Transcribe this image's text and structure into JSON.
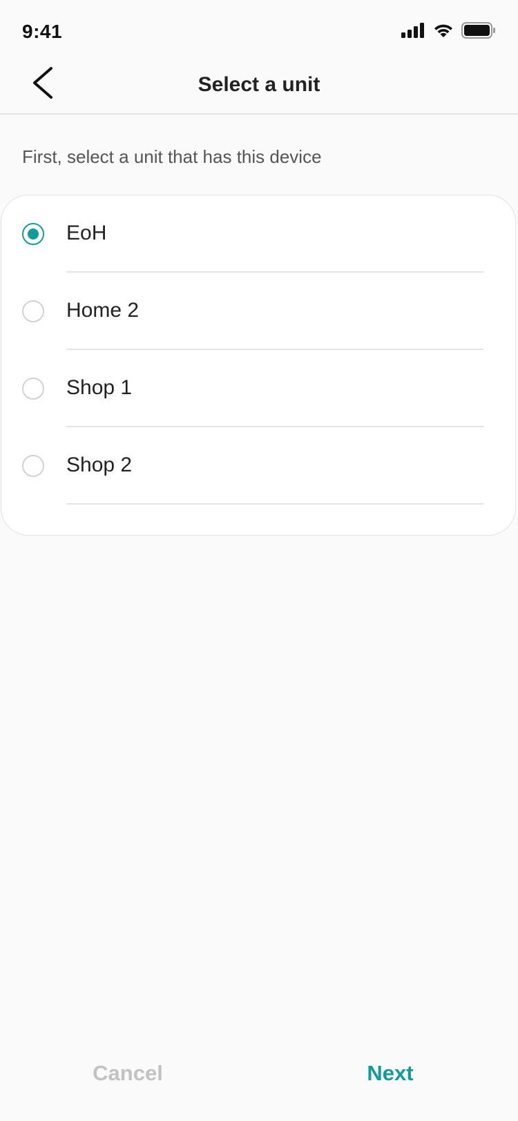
{
  "status_bar": {
    "time": "9:41",
    "icons": [
      "signal-icon",
      "wifi-icon",
      "battery-icon"
    ]
  },
  "header": {
    "title": "Select a unit",
    "back_icon": "chevron-left-icon"
  },
  "instruction": "First, select a unit that has this device",
  "units": [
    {
      "label": "EoH",
      "selected": true
    },
    {
      "label": "Home 2",
      "selected": false
    },
    {
      "label": "Shop 1",
      "selected": false
    },
    {
      "label": "Shop 2",
      "selected": false
    }
  ],
  "footer": {
    "cancel_label": "Cancel",
    "next_label": "Next"
  },
  "colors": {
    "accent": "#119b9b",
    "disabled_text": "#c2c2c2",
    "background": "#fafafa",
    "card": "#ffffff"
  }
}
